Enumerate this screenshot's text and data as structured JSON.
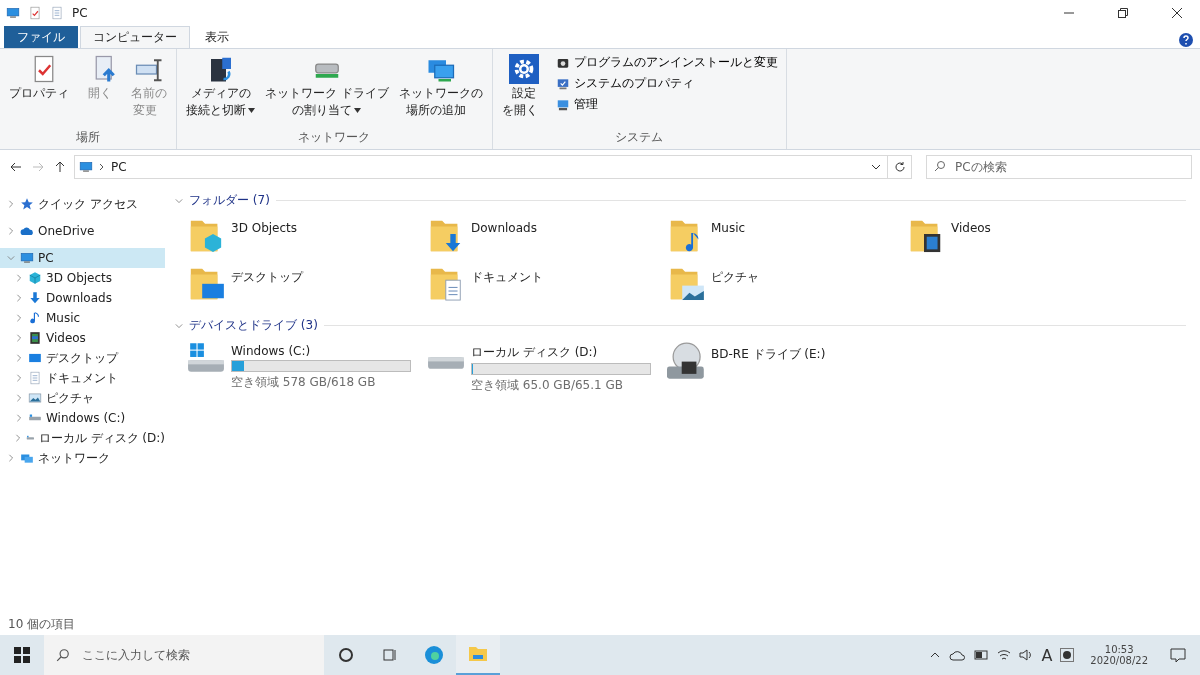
{
  "window": {
    "title": "PC"
  },
  "ribbon": {
    "tabs": [
      {
        "label": "ファイル",
        "kind": "file",
        "selected": false
      },
      {
        "label": "コンピューター",
        "kind": "tab",
        "selected": true
      },
      {
        "label": "表示",
        "kind": "tab",
        "selected": false
      }
    ],
    "groups": [
      {
        "label": "場所",
        "buttons": [
          {
            "kind": "properties",
            "lines": [
              "プロパティ"
            ],
            "dropdown": false,
            "disabled": false
          },
          {
            "kind": "open",
            "lines": [
              "開く"
            ],
            "dropdown": false,
            "disabled": true
          },
          {
            "kind": "rename",
            "lines": [
              "名前の",
              "変更"
            ],
            "dropdown": false,
            "disabled": true
          }
        ]
      },
      {
        "label": "ネットワーク",
        "buttons": [
          {
            "kind": "media",
            "lines": [
              "メディアの",
              "接続と切断"
            ],
            "dropdown": true,
            "disabled": false
          },
          {
            "kind": "netdrive",
            "lines": [
              "ネットワーク ドライブ",
              "の割り当て"
            ],
            "dropdown": true,
            "disabled": false
          },
          {
            "kind": "netplace",
            "lines": [
              "ネットワークの",
              "場所の追加"
            ],
            "dropdown": false,
            "disabled": false
          }
        ]
      },
      {
        "label": "システム",
        "buttons": [
          {
            "kind": "settings",
            "lines": [
              "設定",
              "を開く"
            ],
            "dropdown": false,
            "disabled": false
          }
        ],
        "small": [
          {
            "kind": "uninstall",
            "label": "プログラムのアンインストールと変更"
          },
          {
            "kind": "sysprops",
            "label": "システムのプロパティ"
          },
          {
            "kind": "manage",
            "label": "管理"
          }
        ]
      }
    ]
  },
  "address": {
    "path": "PC",
    "search_placeholder": "PCの検索"
  },
  "sidebar": {
    "items": [
      {
        "label": "クイック アクセス",
        "kind": "star",
        "expanded": false,
        "selected": false
      },
      {
        "label": "OneDrive",
        "kind": "cloud",
        "expanded": false,
        "selected": false
      },
      {
        "label": "PC",
        "kind": "pc",
        "expanded": true,
        "selected": true,
        "children": [
          {
            "label": "3D Objects",
            "kind": "cube",
            "expanded": false,
            "selected": false
          },
          {
            "label": "Downloads",
            "kind": "download",
            "expanded": false,
            "selected": false
          },
          {
            "label": "Music",
            "kind": "music",
            "expanded": false,
            "selected": false
          },
          {
            "label": "Videos",
            "kind": "video",
            "expanded": false,
            "selected": false
          },
          {
            "label": "デスクトップ",
            "kind": "desktop",
            "expanded": false,
            "selected": false
          },
          {
            "label": "ドキュメント",
            "kind": "document",
            "expanded": false,
            "selected": false
          },
          {
            "label": "ピクチャ",
            "kind": "picture",
            "expanded": false,
            "selected": false
          },
          {
            "label": "Windows (C:)",
            "kind": "drive",
            "expanded": false,
            "selected": false
          },
          {
            "label": "ローカル ディスク (D:)",
            "kind": "drive",
            "expanded": false,
            "selected": false
          }
        ]
      },
      {
        "label": "ネットワーク",
        "kind": "network",
        "expanded": false,
        "selected": false
      }
    ]
  },
  "sections": [
    {
      "title": "フォルダー (7)",
      "expanded": true,
      "items": [
        {
          "kind": "cube",
          "name": "3D Objects"
        },
        {
          "kind": "download",
          "name": "Downloads"
        },
        {
          "kind": "music",
          "name": "Music"
        },
        {
          "kind": "video",
          "name": "Videos"
        },
        {
          "kind": "desktop",
          "name": "デスクトップ"
        },
        {
          "kind": "document",
          "name": "ドキュメント"
        },
        {
          "kind": "picture",
          "name": "ピクチャ"
        }
      ]
    },
    {
      "title": "デバイスとドライブ (3)",
      "expanded": true,
      "items": [
        {
          "kind": "windrive",
          "name": "Windows (C:)",
          "level": 0.065,
          "free": "空き領域 578 GB/618 GB"
        },
        {
          "kind": "hdd",
          "name": "ローカル ディスク (D:)",
          "level": 0.002,
          "free": "空き領域 65.0 GB/65.1 GB"
        },
        {
          "kind": "bd",
          "name": "BD-RE ドライブ (E:)"
        }
      ]
    }
  ],
  "status_bar": {
    "count": "10 個の項目"
  },
  "taskbar": {
    "search_placeholder": "ここに入力して検索",
    "ime": "A",
    "time": "10:53",
    "date": "2020/08/22"
  }
}
